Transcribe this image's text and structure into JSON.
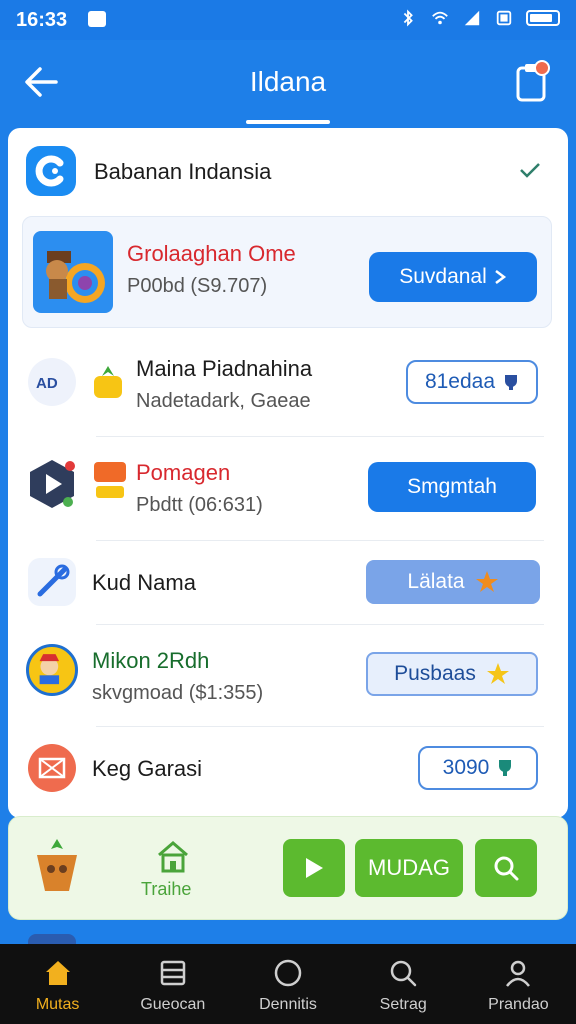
{
  "status_bar": {
    "time": "16:33"
  },
  "header": {
    "title": "Ildana"
  },
  "card": {
    "title": "Babanan Indansia",
    "rows": [
      {
        "title": "Grolaaghan Ome",
        "subtitle": "P00bd (S9.707)",
        "button": "Suvdanal"
      },
      {
        "title": "Maina Piadnahina",
        "subtitle": "Nadetadark, Gaeae",
        "button": "81edaa"
      },
      {
        "title": "Pomagen",
        "subtitle": "Pbdtt (06:631)",
        "button": "Smgmtah"
      },
      {
        "title": "Kud Nama",
        "subtitle": "",
        "button": "Lälata"
      },
      {
        "title": "Mikon 2Rdh",
        "subtitle": "skvgmoad ($1:355)",
        "button": "Pusbaas"
      },
      {
        "title": "Keg Garasi",
        "subtitle": "",
        "button": "3090"
      }
    ]
  },
  "promo": {
    "house_label": "Traihe",
    "mid_button": "MUDAG"
  },
  "bottom_nav": [
    {
      "label": "Mutas",
      "icon": "home-icon"
    },
    {
      "label": "Gueocan",
      "icon": "list-icon"
    },
    {
      "label": "Dennitis",
      "icon": "circle-icon"
    },
    {
      "label": "Setrag",
      "icon": "search-icon"
    },
    {
      "label": "Prandao",
      "icon": "person-icon"
    }
  ],
  "colors": {
    "primary": "#1e7fe8",
    "green": "#5cba2f",
    "nav_active": "#f2b01e"
  }
}
